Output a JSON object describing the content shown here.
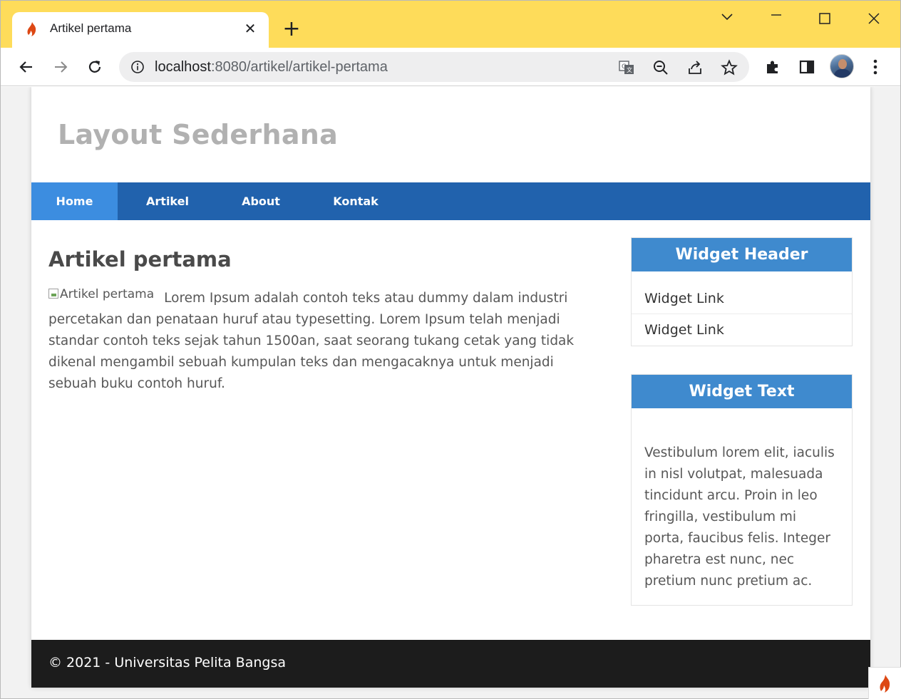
{
  "browser": {
    "tab_title": "Artikel pertama",
    "tab_close": "✕",
    "new_tab": "+",
    "url_host": "localhost",
    "url_path": ":8080/artikel/artikel-pertama",
    "title_bar_color": "#fedc5a"
  },
  "site": {
    "title": "Layout Sederhana",
    "nav": [
      {
        "label": "Home",
        "active": true
      },
      {
        "label": "Artikel",
        "active": false
      },
      {
        "label": "About",
        "active": false
      },
      {
        "label": "Kontak",
        "active": false
      }
    ],
    "nav_color": "#2162ad",
    "nav_active_color": "#3c8de0"
  },
  "article": {
    "title": "Artikel pertama",
    "image_alt": "Artikel pertama",
    "body": "Lorem Ipsum adalah contoh teks atau dummy dalam industri percetakan dan penataan huruf atau typesetting. Lorem Ipsum telah menjadi standar contoh teks sejak tahun 1500an, saat seorang tukang cetak yang tidak dikenal mengambil sebuah kumpulan teks dan mengacaknya untuk menjadi sebuah buku contoh huruf."
  },
  "sidebar": {
    "widget_links": {
      "header": "Widget Header",
      "links": [
        "Widget Link",
        "Widget Link"
      ]
    },
    "widget_text": {
      "header": "Widget Text",
      "text": "Vestibulum lorem elit, iaculis in nisl volutpat, malesuada tincidunt arcu. Proin in leo fringilla, vestibulum mi porta, faucibus felis. Integer pharetra est nunc, nec pretium nunc pretium ac."
    },
    "widget_header_color": "#3f8ace"
  },
  "footer": {
    "text": "© 2021 - Universitas Pelita Bangsa",
    "color": "#1c1c1c"
  }
}
